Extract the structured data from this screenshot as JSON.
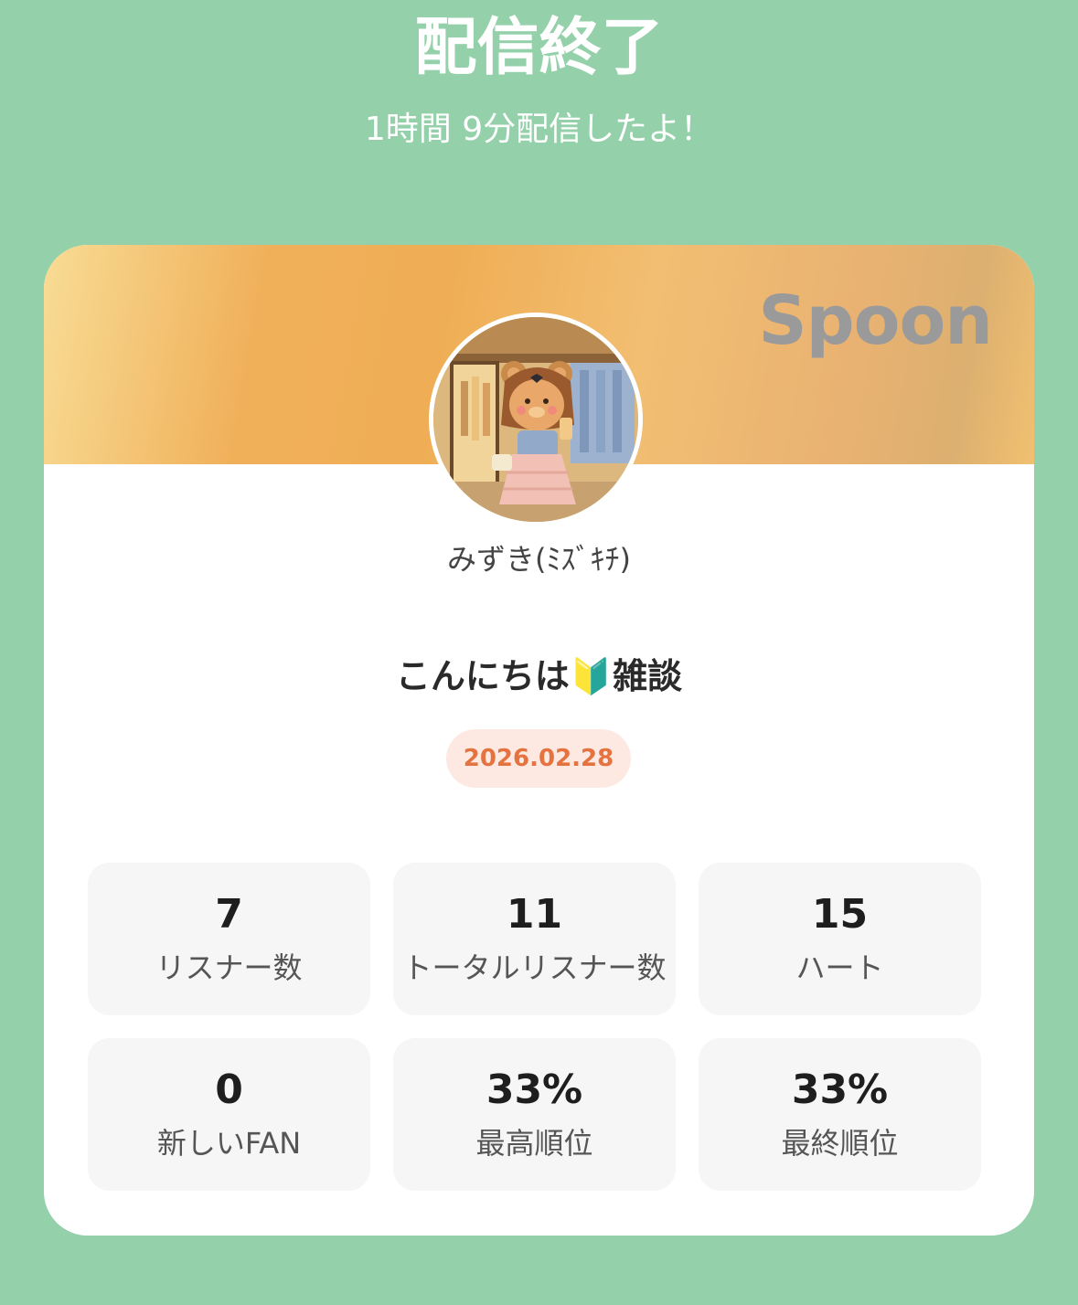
{
  "header": {
    "title": "配信終了",
    "duration": "1時間 9分配信したよ！"
  },
  "card": {
    "brand": "Spoon",
    "username": "みずき(ﾐｽﾞｷﾁ)",
    "stream_title": "こんにちは🔰雑談",
    "date": "2026.02.28",
    "stats": [
      {
        "value": "7",
        "label": "リスナー数"
      },
      {
        "value": "11",
        "label": "トータルリスナー数"
      },
      {
        "value": "15",
        "label": "ハート"
      },
      {
        "value": "0",
        "label": "新しいFAN"
      },
      {
        "value": "33%",
        "label": "最高順位"
      },
      {
        "value": "33%",
        "label": "最終順位"
      }
    ]
  },
  "colors": {
    "background": "#94d1aa",
    "banner_orange": "#f0b05a",
    "date_text": "#e5733f",
    "date_pill": "#fde9e2",
    "stat_card": "#f6f6f6"
  },
  "icons": {
    "beginner_mark": "beginner-mark-icon"
  }
}
